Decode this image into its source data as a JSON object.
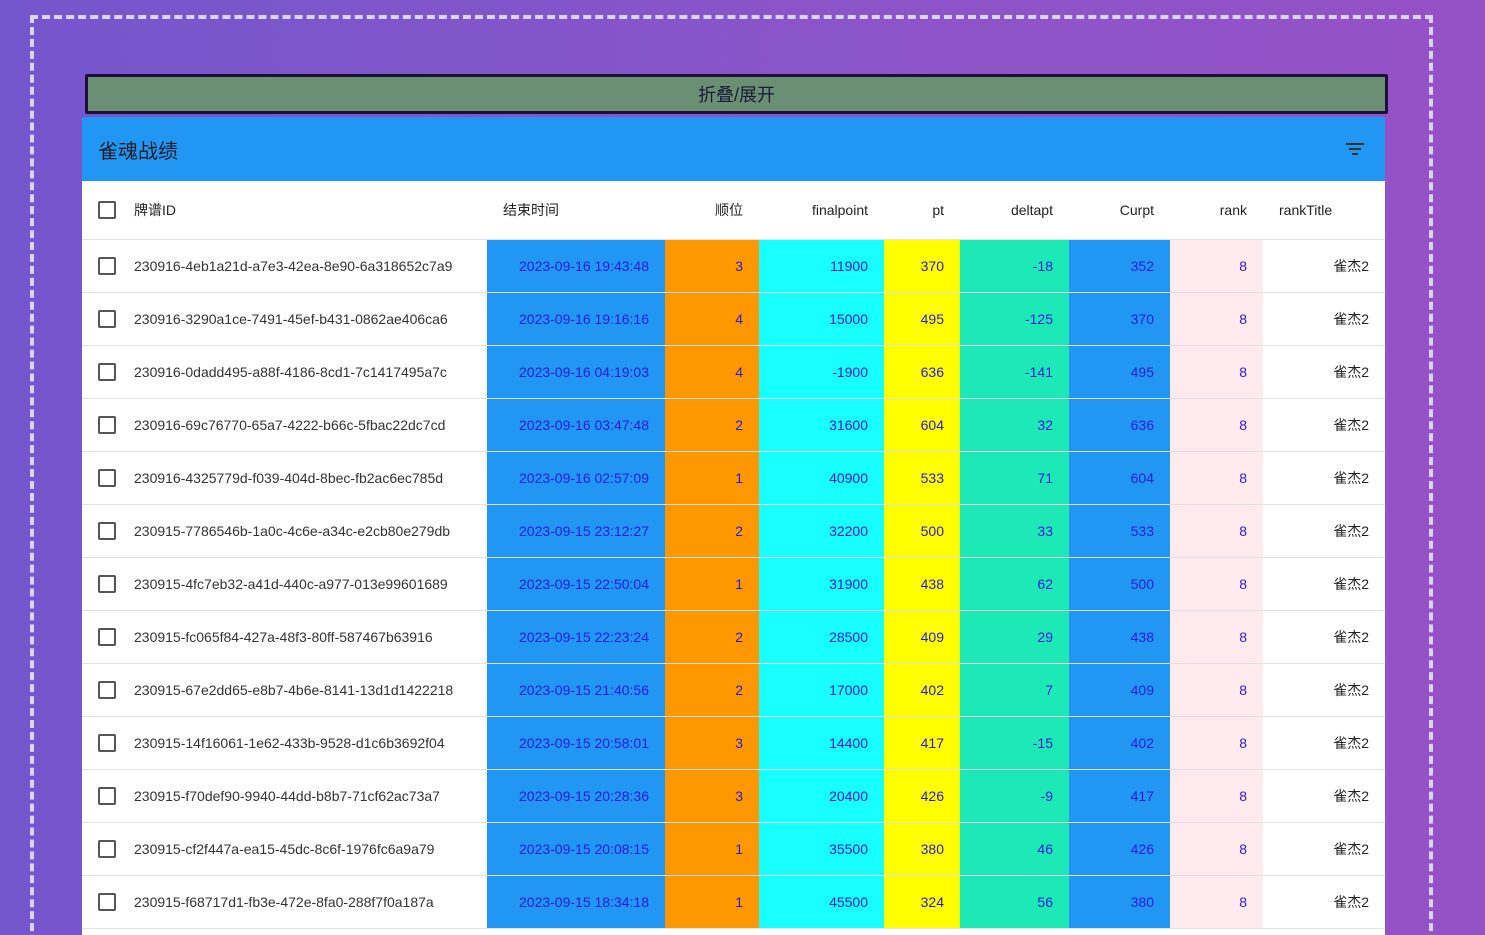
{
  "toggle_button": {
    "label": "折叠/展开"
  },
  "toolbar": {
    "title": "雀魂战绩",
    "filter_icon": "filter-list-icon"
  },
  "table": {
    "headers": {
      "id": "牌谱ID",
      "end_time": "结束时间",
      "position": "顺位",
      "finalpoint": "finalpoint",
      "pt": "pt",
      "deltapt": "deltapt",
      "curpt": "Curpt",
      "rank": "rank",
      "rank_title": "rankTitle"
    },
    "rows": [
      {
        "id": "230916-4eb1a21d-a7e3-42ea-8e90-6a318652c7a9",
        "end_time": "2023-09-16 19:43:48",
        "position": "3",
        "finalpoint": "11900",
        "pt": "370",
        "deltapt": "-18",
        "curpt": "352",
        "rank": "8",
        "rank_title": "雀杰2"
      },
      {
        "id": "230916-3290a1ce-7491-45ef-b431-0862ae406ca6",
        "end_time": "2023-09-16 19:16:16",
        "position": "4",
        "finalpoint": "15000",
        "pt": "495",
        "deltapt": "-125",
        "curpt": "370",
        "rank": "8",
        "rank_title": "雀杰2"
      },
      {
        "id": "230916-0dadd495-a88f-4186-8cd1-7c1417495a7c",
        "end_time": "2023-09-16 04:19:03",
        "position": "4",
        "finalpoint": "-1900",
        "pt": "636",
        "deltapt": "-141",
        "curpt": "495",
        "rank": "8",
        "rank_title": "雀杰2"
      },
      {
        "id": "230916-69c76770-65a7-4222-b66c-5fbac22dc7cd",
        "end_time": "2023-09-16 03:47:48",
        "position": "2",
        "finalpoint": "31600",
        "pt": "604",
        "deltapt": "32",
        "curpt": "636",
        "rank": "8",
        "rank_title": "雀杰2"
      },
      {
        "id": "230916-4325779d-f039-404d-8bec-fb2ac6ec785d",
        "end_time": "2023-09-16 02:57:09",
        "position": "1",
        "finalpoint": "40900",
        "pt": "533",
        "deltapt": "71",
        "curpt": "604",
        "rank": "8",
        "rank_title": "雀杰2"
      },
      {
        "id": "230915-7786546b-1a0c-4c6e-a34c-e2cb80e279db",
        "end_time": "2023-09-15 23:12:27",
        "position": "2",
        "finalpoint": "32200",
        "pt": "500",
        "deltapt": "33",
        "curpt": "533",
        "rank": "8",
        "rank_title": "雀杰2"
      },
      {
        "id": "230915-4fc7eb32-a41d-440c-a977-013e99601689",
        "end_time": "2023-09-15 22:50:04",
        "position": "1",
        "finalpoint": "31900",
        "pt": "438",
        "deltapt": "62",
        "curpt": "500",
        "rank": "8",
        "rank_title": "雀杰2"
      },
      {
        "id": "230915-fc065f84-427a-48f3-80ff-587467b63916",
        "end_time": "2023-09-15 22:23:24",
        "position": "2",
        "finalpoint": "28500",
        "pt": "409",
        "deltapt": "29",
        "curpt": "438",
        "rank": "8",
        "rank_title": "雀杰2"
      },
      {
        "id": "230915-67e2dd65-e8b7-4b6e-8141-13d1d1422218",
        "end_time": "2023-09-15 21:40:56",
        "position": "2",
        "finalpoint": "17000",
        "pt": "402",
        "deltapt": "7",
        "curpt": "409",
        "rank": "8",
        "rank_title": "雀杰2"
      },
      {
        "id": "230915-14f16061-1e62-433b-9528-d1c6b3692f04",
        "end_time": "2023-09-15 20:58:01",
        "position": "3",
        "finalpoint": "14400",
        "pt": "417",
        "deltapt": "-15",
        "curpt": "402",
        "rank": "8",
        "rank_title": "雀杰2"
      },
      {
        "id": "230915-f70def90-9940-44dd-b8b7-71cf62ac73a7",
        "end_time": "2023-09-15 20:28:36",
        "position": "3",
        "finalpoint": "20400",
        "pt": "426",
        "deltapt": "-9",
        "curpt": "417",
        "rank": "8",
        "rank_title": "雀杰2"
      },
      {
        "id": "230915-cf2f447a-ea15-45dc-8c6f-1976fc6a9a79",
        "end_time": "2023-09-15 20:08:15",
        "position": "1",
        "finalpoint": "35500",
        "pt": "380",
        "deltapt": "46",
        "curpt": "426",
        "rank": "8",
        "rank_title": "雀杰2"
      },
      {
        "id": "230915-f68717d1-fb3e-472e-8fa0-288f7f0a187a",
        "end_time": "2023-09-15 18:34:18",
        "position": "1",
        "finalpoint": "45500",
        "pt": "324",
        "deltapt": "56",
        "curpt": "380",
        "rank": "8",
        "rank_title": "雀杰2"
      }
    ]
  }
}
